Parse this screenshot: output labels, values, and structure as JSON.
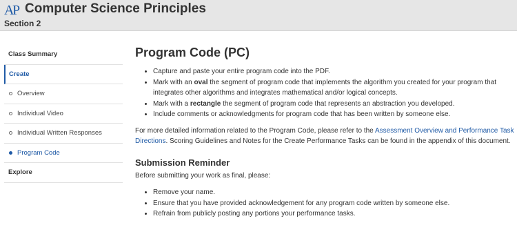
{
  "header": {
    "logo_text": "AP",
    "title": "Computer Science Principles",
    "subtitle": "Section 2"
  },
  "sidebar": {
    "items": [
      {
        "label": "Class Summary"
      },
      {
        "label": "Create"
      },
      {
        "label": "Overview"
      },
      {
        "label": "Individual Video"
      },
      {
        "label": "Individual Written Responses"
      },
      {
        "label": "Program Code"
      },
      {
        "label": "Explore"
      }
    ]
  },
  "main": {
    "title": "Program Code (PC)",
    "bullets": [
      {
        "text": "Capture and paste your entire program code into the PDF."
      },
      {
        "pre": "Mark with an ",
        "bold": "oval",
        "post": " the segment of program code that implements the algorithm you created for your program that integrates other algorithms and integrates mathematical and/or logical concepts."
      },
      {
        "pre": "Mark with a ",
        "bold": "rectangle",
        "post": " the segment of program code that represents an abstraction you developed."
      },
      {
        "text": "Include comments or acknowledgments for program code that has been written by someone else."
      }
    ],
    "para_pre": "For more detailed information related to the Program Code, please refer to the ",
    "para_link": "Assessment Overview and Performance Task Directions",
    "para_post": ". Scoring Guidelines and Notes for the Create Performance Tasks can be found in the appendix of this document.",
    "reminder_title": "Submission Reminder",
    "reminder_intro": "Before submitting your work as final, please:",
    "reminder_bullets": [
      "Remove your name.",
      "Ensure that you have provided acknowledgement for any program code written by someone else.",
      "Refrain from publicly posting any portions your performance tasks."
    ]
  }
}
